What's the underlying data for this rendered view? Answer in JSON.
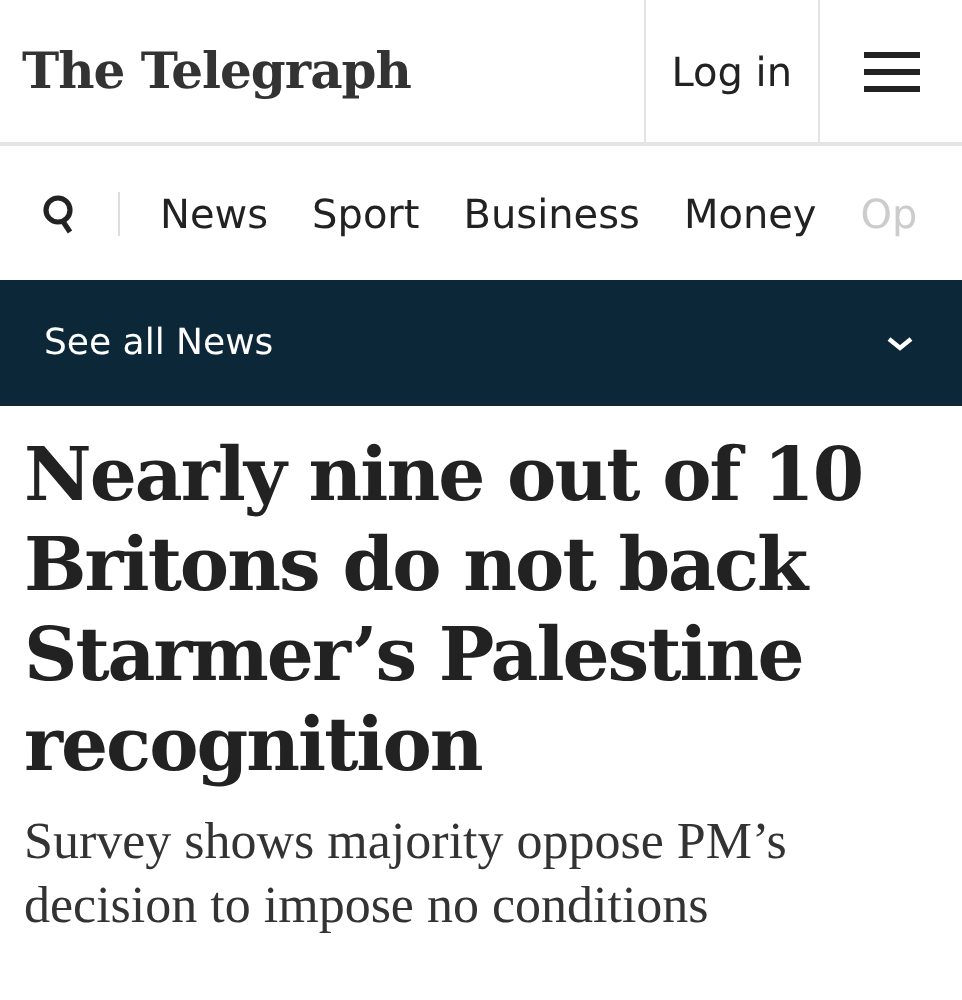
{
  "header": {
    "logo": "The Telegraph",
    "login": "Log in"
  },
  "nav": {
    "items": [
      {
        "label": "News",
        "faded": false
      },
      {
        "label": "Sport",
        "faded": false
      },
      {
        "label": "Business",
        "faded": false
      },
      {
        "label": "Money",
        "faded": false
      },
      {
        "label": "Op",
        "faded": true
      }
    ]
  },
  "section_bar": {
    "label": "See all News"
  },
  "article": {
    "headline": "Nearly nine out of 10 Britons do not back Starmer’s Palestine recognition",
    "standfirst": "Survey shows majority oppose PM’s decision to impose no conditions"
  }
}
